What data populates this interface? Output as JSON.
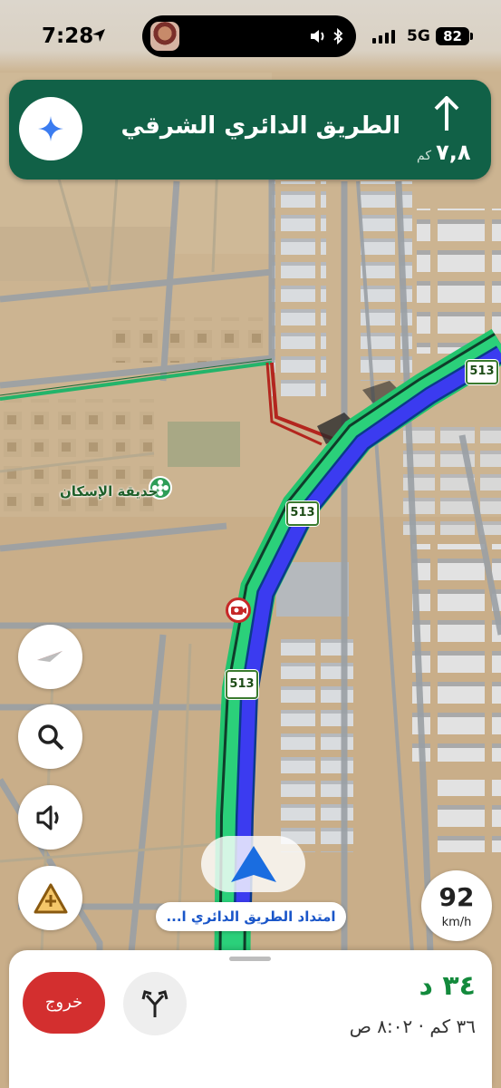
{
  "status_bar": {
    "time": "7:28",
    "network": "5G",
    "battery": "82",
    "location_icon": "location-arrow-icon",
    "island_icons": [
      "speaker-icon",
      "bluetooth-icon"
    ]
  },
  "direction": {
    "street": "الطريق الدائري الشرقي",
    "distance": "٧,٨",
    "unit": "كم",
    "maneuver_icon": "straight-arrow-icon",
    "assistant_icon": "gemini-sparkle-icon"
  },
  "controls": {
    "compass_icon": "compass-icon",
    "search_icon": "search-icon",
    "sound_icon": "speaker-icon",
    "report_icon": "report-incident-icon"
  },
  "map": {
    "poi_name": "حديقة الإسكان",
    "route_shields": [
      "513",
      "513",
      "513"
    ],
    "current_road": "امتداد الطريق الدائري ا...",
    "colors": {
      "route": "#3b3bf0",
      "route_edge": "#0a3a8a",
      "traffic_green": "#21c46e",
      "traffic_red": "#b3261e"
    }
  },
  "speed": {
    "value": "92",
    "unit": "km/h"
  },
  "trip": {
    "exit_label": "خروج",
    "eta_duration": "٣٤ د",
    "eta_details": "٣٦ كم · ٨:٠٢ ص",
    "alternatives_icon": "alternate-routes-icon"
  }
}
